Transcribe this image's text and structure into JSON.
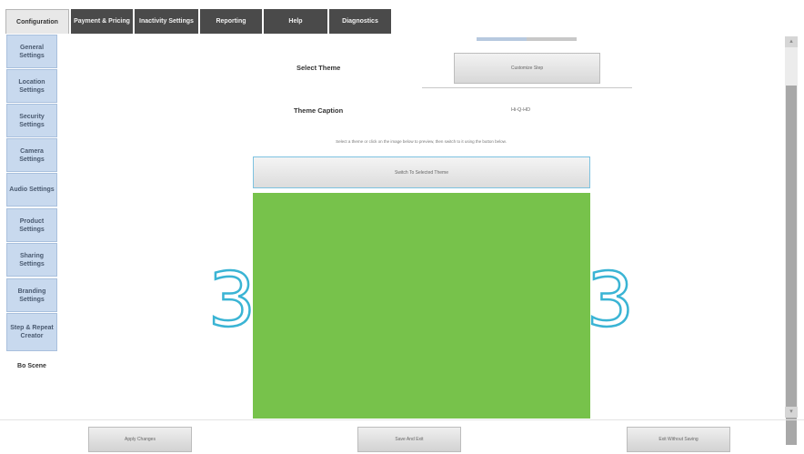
{
  "tabs": [
    {
      "label": "Configuration",
      "active": true
    },
    {
      "label": "Payment & Pricing",
      "active": false
    },
    {
      "label": "Inactivity Settings",
      "active": false
    },
    {
      "label": "Reporting",
      "active": false
    },
    {
      "label": "Help",
      "active": false
    },
    {
      "label": "Diagnostics",
      "active": false
    }
  ],
  "sidebar": {
    "items": [
      {
        "label": "General Settings"
      },
      {
        "label": "Location Settings"
      },
      {
        "label": "Security Settings"
      },
      {
        "label": "Camera Settings"
      },
      {
        "label": "Audio Settings"
      },
      {
        "label": "Product Settings"
      },
      {
        "label": "Sharing Settings"
      },
      {
        "label": "Branding Settings"
      },
      {
        "label": "Step & Repeat Creator"
      }
    ],
    "plain_item": "Bo Scene"
  },
  "main": {
    "select_theme_label": "Select Theme",
    "theme_button_label": "Customize Step",
    "theme_caption_label": "Theme Caption",
    "theme_caption_value": "Hi-Q-HD",
    "hint_text": "Select a theme or click on the image below to preview, then switch to it using the button below.",
    "switch_button_label": "Switch To Selected Theme",
    "preview_color": "#77c24b",
    "countdown_digit": "3",
    "digit_color": "#3ab4d4"
  },
  "footer": {
    "apply_label": "Apply Changes",
    "save_label": "Save And Exit",
    "exit_label": "Exit Without Saving"
  }
}
